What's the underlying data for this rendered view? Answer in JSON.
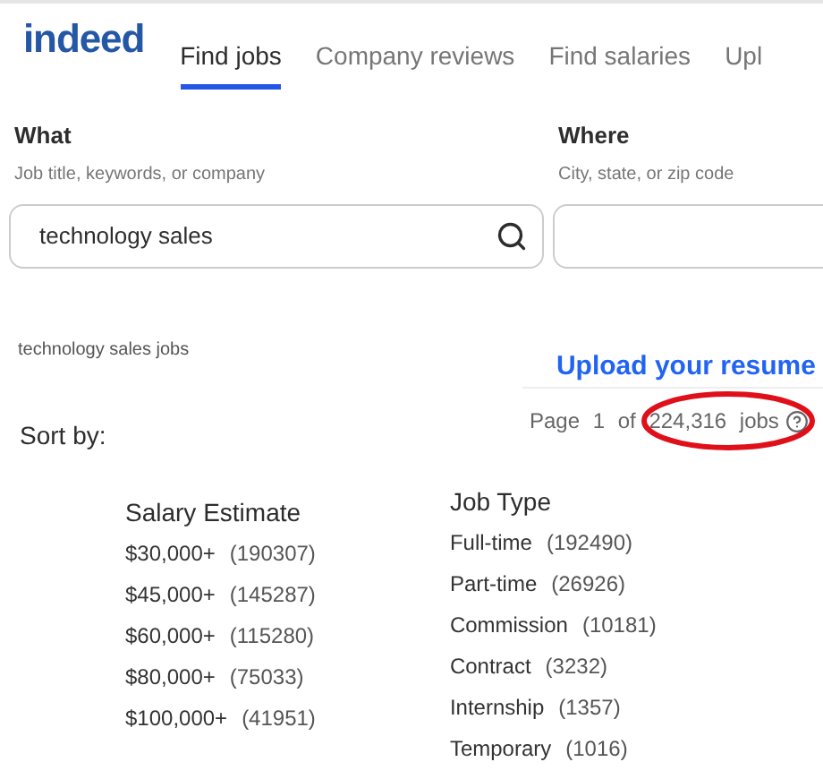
{
  "logo": "indeed",
  "tabs": [
    {
      "label": "Find jobs",
      "selected": true
    },
    {
      "label": "Company reviews",
      "selected": false
    },
    {
      "label": "Find salaries",
      "selected": false
    },
    {
      "label": "Upl",
      "selected": false
    }
  ],
  "search": {
    "what": {
      "label": "What",
      "hint": "Job title, keywords, or company",
      "value": "technology sales"
    },
    "where": {
      "label": "Where",
      "hint": "City, state, or zip code"
    }
  },
  "results_heading": "technology sales jobs",
  "upload_resume": "Upload your resume",
  "sort_by": "Sort by:",
  "page_count": "Page 1 of 224,316 jobs",
  "filters": [
    {
      "title": "Salary Estimate",
      "options": [
        {
          "label": "$30,000+",
          "count": "(190307)"
        },
        {
          "label": "$45,000+",
          "count": "(145287)"
        },
        {
          "label": "$60,000+",
          "count": "(115280)"
        },
        {
          "label": "$80,000+",
          "count": "(75033)"
        },
        {
          "label": "$100,000+",
          "count": "(41951)"
        }
      ]
    },
    {
      "title": "Job Type",
      "options": [
        {
          "label": "Full-time",
          "count": "(192490)"
        },
        {
          "label": "Part-time",
          "count": "(26926)"
        },
        {
          "label": "Commission",
          "count": "(10181)"
        },
        {
          "label": "Contract",
          "count": "(3232)"
        },
        {
          "label": "Internship",
          "count": "(1357)"
        },
        {
          "label": "Temporary",
          "count": "(1016)"
        }
      ]
    }
  ]
}
